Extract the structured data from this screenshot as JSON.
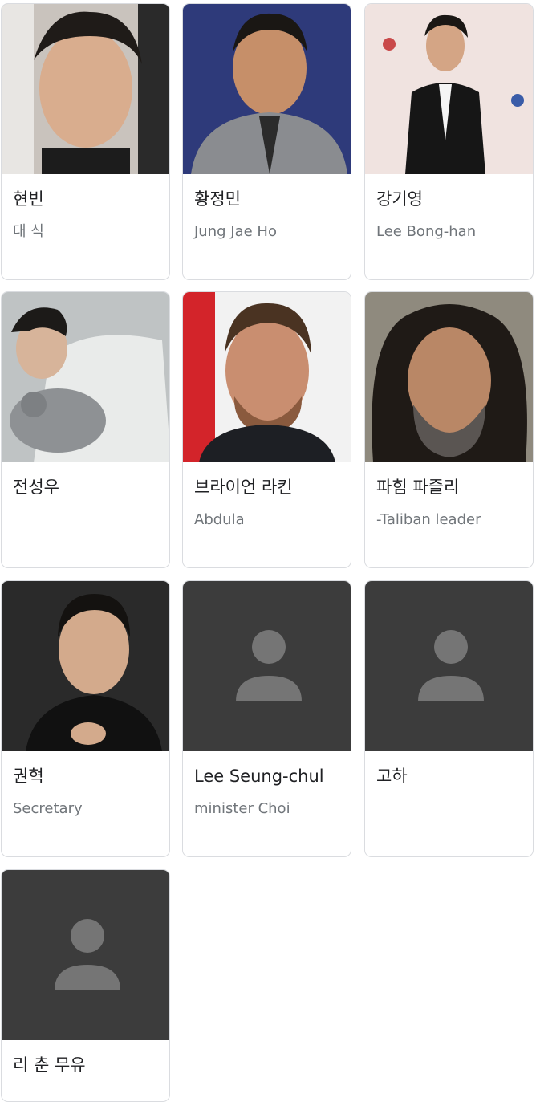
{
  "cast": [
    {
      "name": "현빈",
      "role": "대 식",
      "photo": "portrait"
    },
    {
      "name": "황정민",
      "role": "Jung Jae Ho",
      "photo": "portrait"
    },
    {
      "name": "강기영",
      "role": "Lee Bong-han",
      "photo": "portrait"
    },
    {
      "name": "전성우",
      "role": "",
      "photo": "portrait"
    },
    {
      "name": "브라이언 라킨",
      "role": "Abdula",
      "photo": "portrait"
    },
    {
      "name": "파힘 파즐리",
      "role": "-Taliban leader",
      "photo": "portrait"
    },
    {
      "name": "권혁",
      "role": "Secretary",
      "photo": "portrait"
    },
    {
      "name": "Lee Seung-chul",
      "role": "minister Choi",
      "photo": "placeholder-person-icon"
    },
    {
      "name": "고하",
      "role": "",
      "photo": "placeholder-person-icon"
    },
    {
      "name": "리 춘 무유",
      "role": "",
      "photo": "placeholder-person-icon"
    }
  ],
  "colors": {
    "placeholder_bg": "#3c3c3c",
    "placeholder_icon": "#757575",
    "name_text": "#202124",
    "role_text": "#70757a",
    "card_border": "#dadce0"
  }
}
